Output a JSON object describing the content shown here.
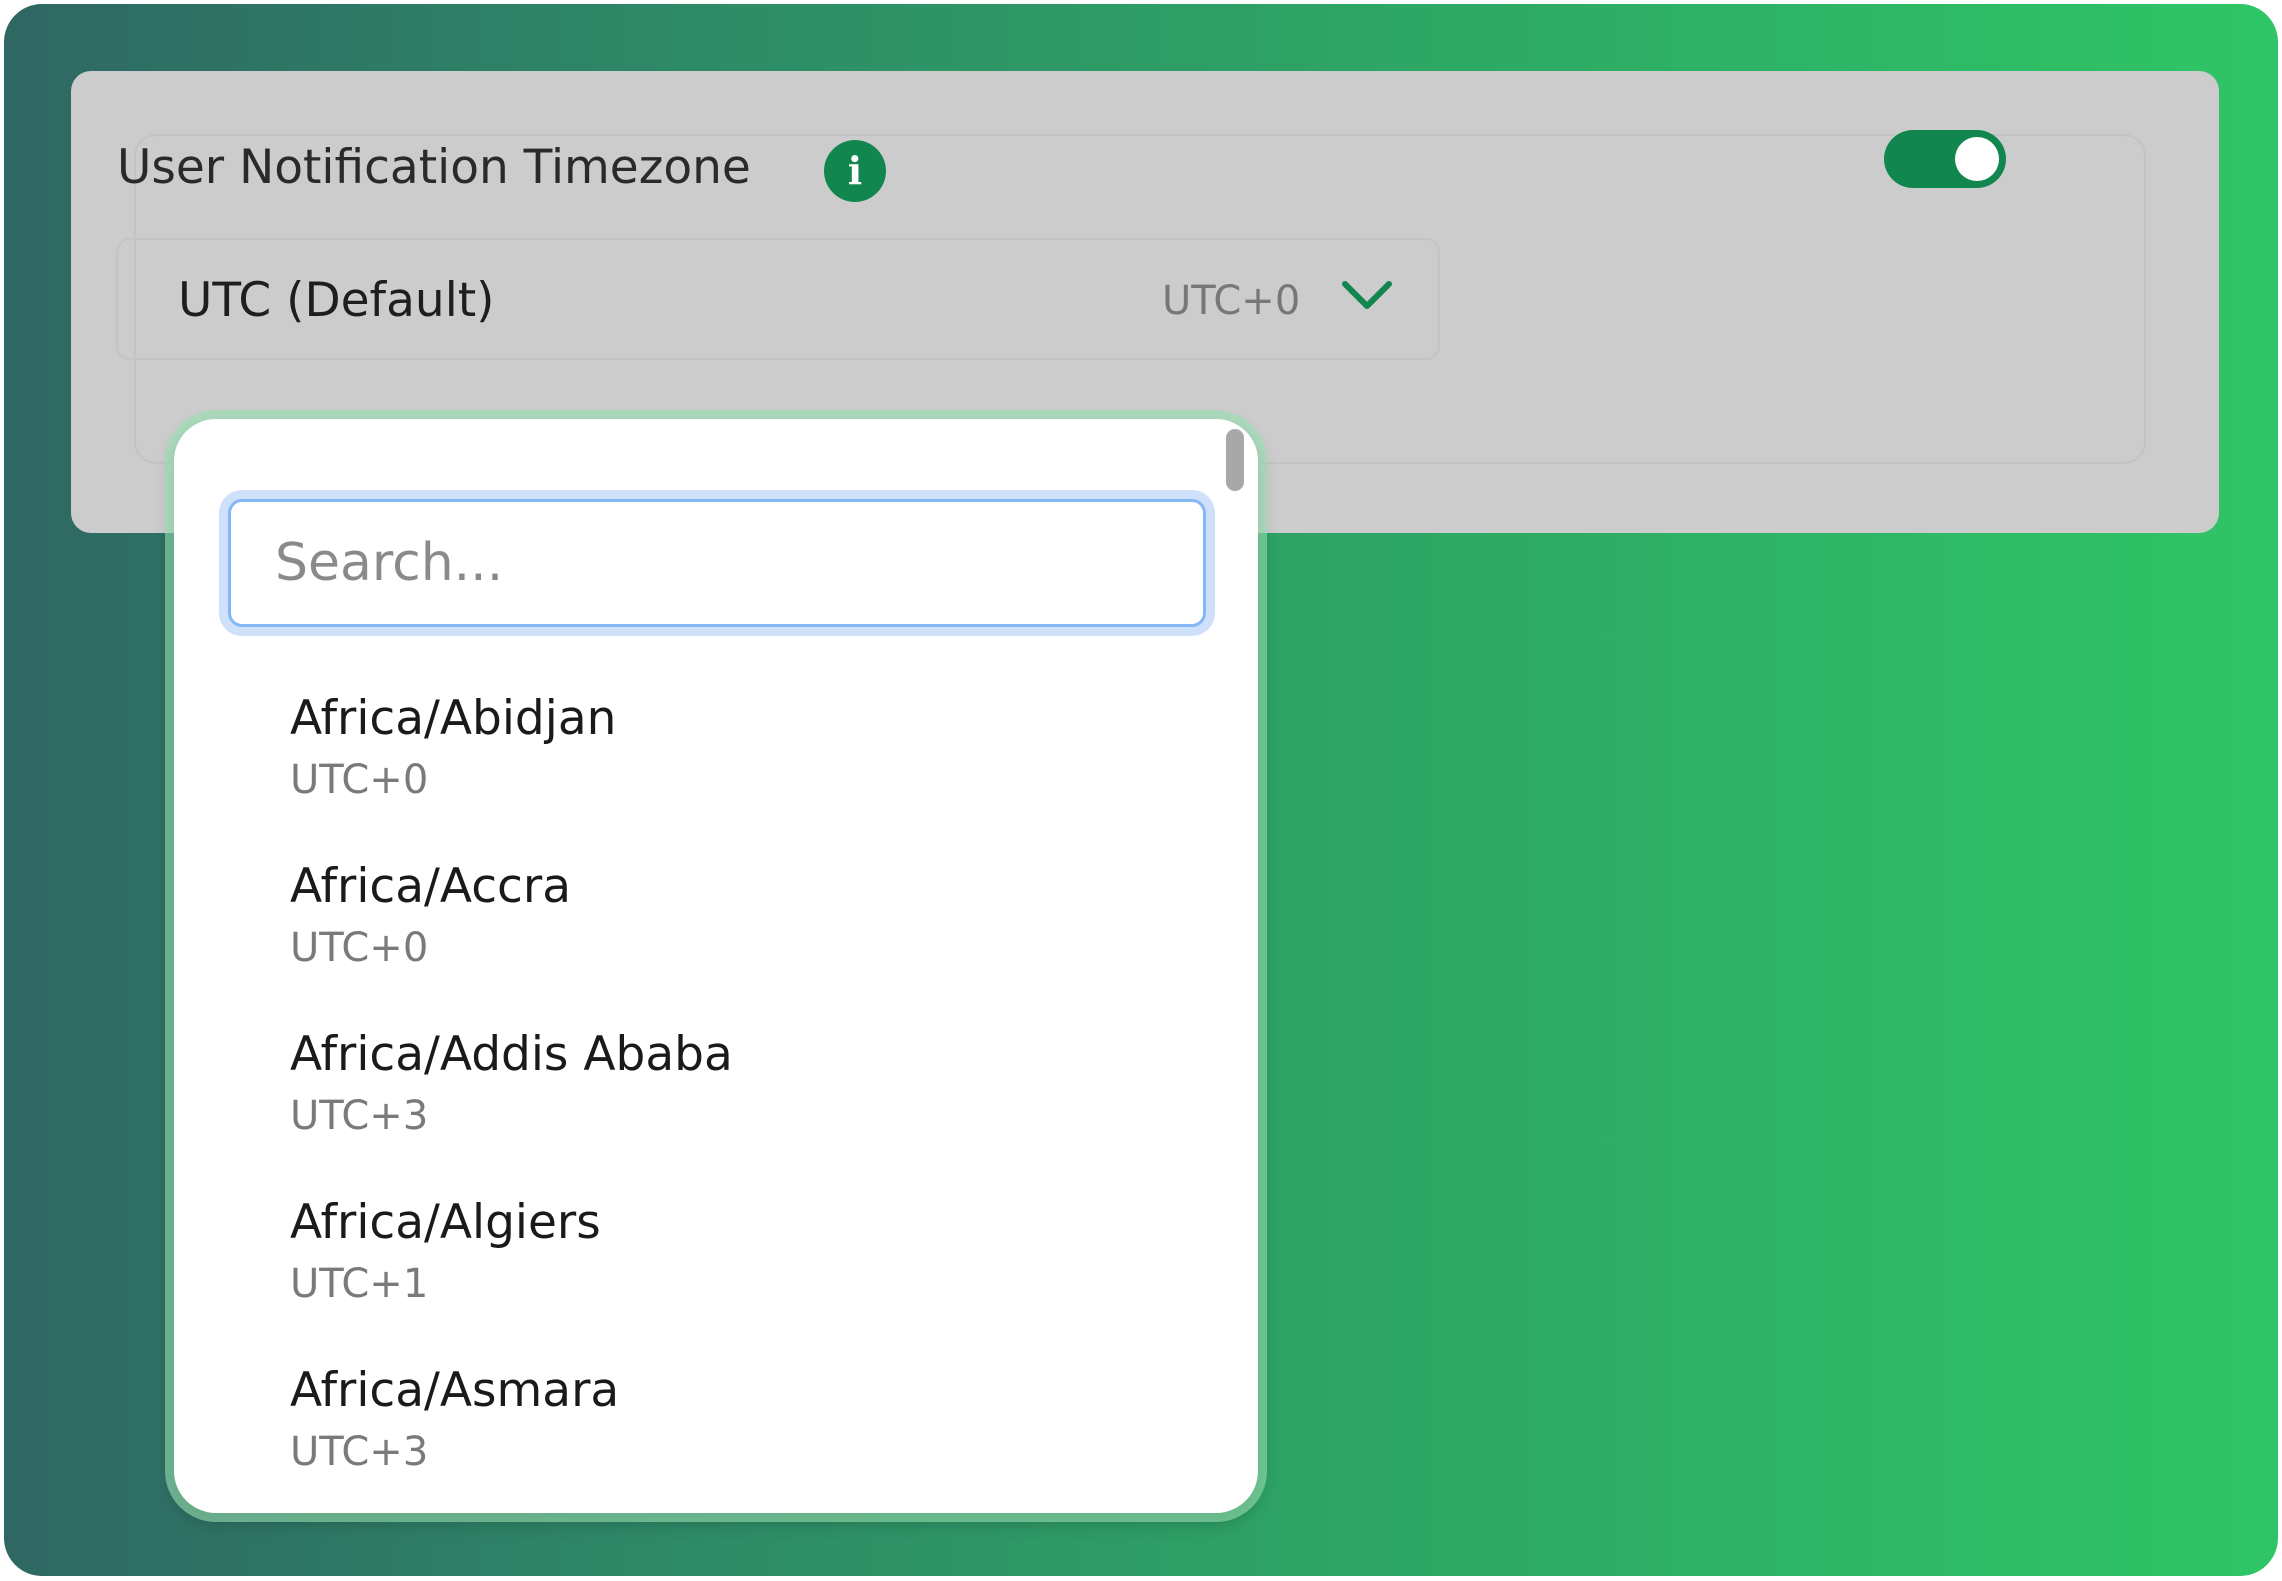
{
  "setting": {
    "title": "User Notification Timezone",
    "info_icon": "info-icon",
    "toggle_on": true,
    "accent_color": "#12864f"
  },
  "select": {
    "value": "UTC (Default)",
    "offset": "UTC+0",
    "icon": "chevron-down-icon"
  },
  "dropdown": {
    "search_placeholder": "Search...",
    "search_value": "",
    "items": [
      {
        "name": "Africa/Abidjan",
        "offset": "UTC+0"
      },
      {
        "name": "Africa/Accra",
        "offset": "UTC+0"
      },
      {
        "name": "Africa/Addis Ababa",
        "offset": "UTC+3"
      },
      {
        "name": "Africa/Algiers",
        "offset": "UTC+1"
      },
      {
        "name": "Africa/Asmara",
        "offset": "UTC+3"
      }
    ]
  }
}
